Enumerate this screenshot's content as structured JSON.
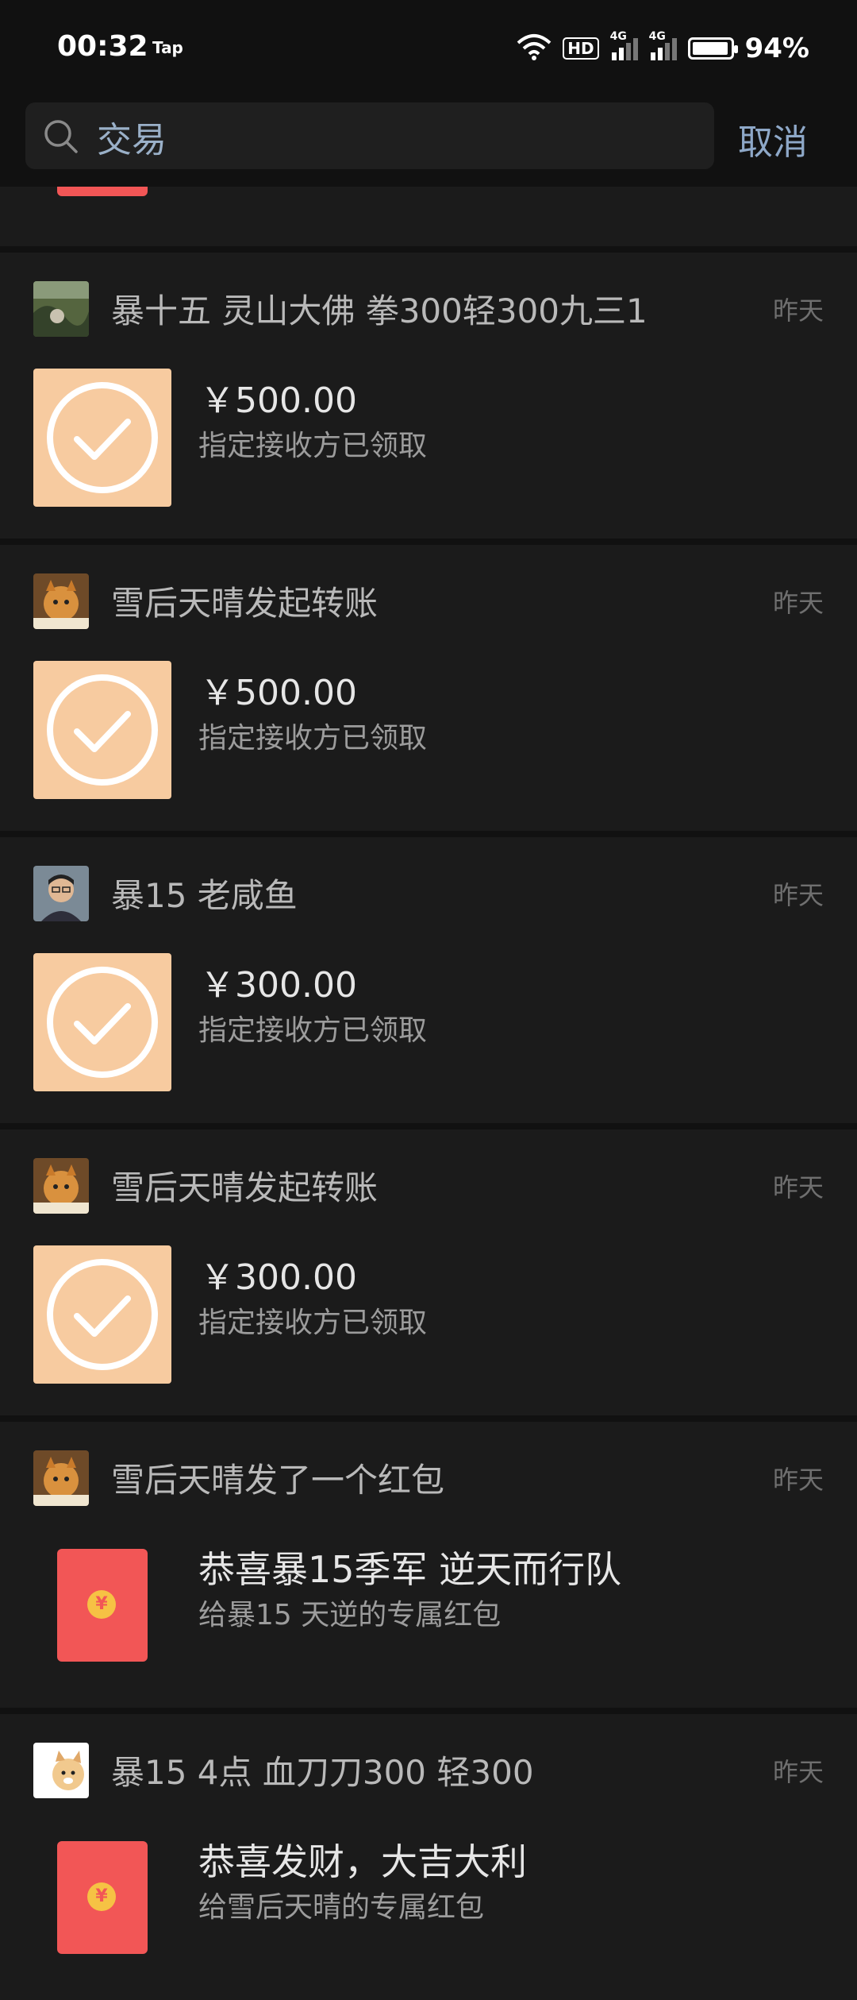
{
  "status_bar": {
    "time": "00:32",
    "app_tag": "Tap",
    "hd_label": "HD",
    "network_1": "4G",
    "network_2": "4G",
    "battery_pct": "94%"
  },
  "search": {
    "query": "交易",
    "cancel_label": "取消"
  },
  "items": [
    {
      "type": "transfer",
      "avatar": "avatar-landscape",
      "title": "暴十五 灵山大佛 拳300轻300九三1",
      "time": "昨天",
      "amount": "￥500.00",
      "status": "指定接收方已领取"
    },
    {
      "type": "transfer",
      "avatar": "avatar-cat",
      "title": "雪后天晴发起转账",
      "time": "昨天",
      "amount": "￥500.00",
      "status": "指定接收方已领取"
    },
    {
      "type": "transfer",
      "avatar": "avatar-person",
      "title": "暴15 老咸鱼",
      "time": "昨天",
      "amount": "￥300.00",
      "status": "指定接收方已领取"
    },
    {
      "type": "transfer",
      "avatar": "avatar-cat",
      "title": "雪后天晴发起转账",
      "time": "昨天",
      "amount": "￥300.00",
      "status": "指定接收方已领取"
    },
    {
      "type": "red_packet",
      "avatar": "avatar-cat",
      "title": "雪后天晴发了一个红包",
      "time": "昨天",
      "packet_title": "恭喜暴15季军  逆天而行队",
      "packet_sub": "给暴15 天逆的专属红包",
      "coin": "¥"
    },
    {
      "type": "red_packet",
      "avatar": "avatar-dog",
      "title": "暴15  4点 血刀刀300 轻300",
      "time": "昨天",
      "packet_title": "恭喜发财，大吉大利",
      "packet_sub": "给雪后天晴的专属红包",
      "coin": "¥"
    }
  ],
  "colors": {
    "background": "#111111",
    "card": "#1b1b1b",
    "transfer_thumb": "#f7cba0",
    "red_packet": "#f25656",
    "accent_link": "#8ea8c8"
  }
}
